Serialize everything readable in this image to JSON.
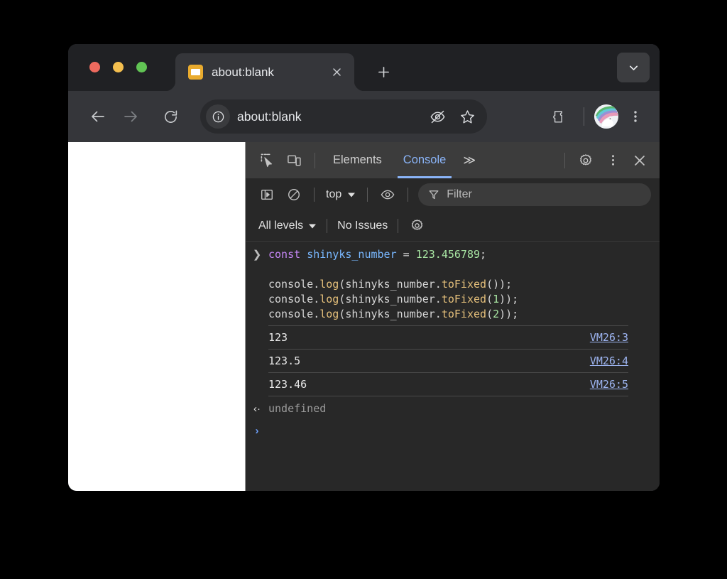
{
  "browser": {
    "tab": {
      "title": "about:blank",
      "favicon_icon": "page-favicon",
      "close_icon": "close-icon"
    },
    "new_tab_icon": "plus-icon",
    "tab_list_icon": "chevron-down-icon",
    "toolbar": {
      "back_icon": "arrow-left-icon",
      "forward_icon": "arrow-right-icon",
      "reload_icon": "reload-icon",
      "site_info_icon": "info-circle-icon",
      "url": "about:blank",
      "hide_icon": "eye-slash-icon",
      "bookmark_icon": "star-icon",
      "extensions_icon": "puzzle-piece-icon",
      "profile_icon": "unicorn-avatar",
      "menu_icon": "three-dots-vertical-icon"
    }
  },
  "devtools": {
    "inspect_icon": "inspect-element-icon",
    "device_toolbar_icon": "device-toolbar-icon",
    "tabs": [
      {
        "label": "Elements",
        "active": false
      },
      {
        "label": "Console",
        "active": true
      }
    ],
    "more_tabs_label": "≫",
    "settings_icon": "gear-icon",
    "more_options_icon": "three-dots-vertical-icon",
    "close_icon": "close-icon",
    "console_toolbar": {
      "sidebar_icon": "console-sidebar-icon",
      "clear_icon": "clear-console-icon",
      "context_label": "top",
      "context_chevron_icon": "chevron-down-icon",
      "live_expression_icon": "eye-icon",
      "filter_icon": "filter-funnel-icon",
      "filter_placeholder": "Filter",
      "filter_value": ""
    },
    "console_filterbar": {
      "levels_label": "All levels",
      "levels_chevron_icon": "chevron-down-icon",
      "issues_label": "No Issues",
      "issues_settings_icon": "gear-icon"
    },
    "console": {
      "input_prompt_icon": "chevron-right-icon",
      "input_lines": [
        [
          {
            "t": "const",
            "c": "tok-kw"
          },
          {
            "t": " ",
            "c": "tok-plain"
          },
          {
            "t": "shinyks_number",
            "c": "tok-var"
          },
          {
            "t": " = ",
            "c": "tok-plain"
          },
          {
            "t": "123.456789",
            "c": "tok-num"
          },
          {
            "t": ";",
            "c": "tok-plain"
          }
        ],
        [
          {
            "t": "",
            "c": "tok-plain"
          }
        ],
        [
          {
            "t": "console.",
            "c": "tok-plain"
          },
          {
            "t": "log",
            "c": "tok-fn"
          },
          {
            "t": "(shinyks_number.",
            "c": "tok-plain"
          },
          {
            "t": "toFixed",
            "c": "tok-fn"
          },
          {
            "t": "());",
            "c": "tok-plain"
          }
        ],
        [
          {
            "t": "console.",
            "c": "tok-plain"
          },
          {
            "t": "log",
            "c": "tok-fn"
          },
          {
            "t": "(shinyks_number.",
            "c": "tok-plain"
          },
          {
            "t": "toFixed",
            "c": "tok-fn"
          },
          {
            "t": "(",
            "c": "tok-plain"
          },
          {
            "t": "1",
            "c": "tok-num"
          },
          {
            "t": "));",
            "c": "tok-plain"
          }
        ],
        [
          {
            "t": "console.",
            "c": "tok-plain"
          },
          {
            "t": "log",
            "c": "tok-fn"
          },
          {
            "t": "(shinyks_number.",
            "c": "tok-plain"
          },
          {
            "t": "toFixed",
            "c": "tok-fn"
          },
          {
            "t": "(",
            "c": "tok-plain"
          },
          {
            "t": "2",
            "c": "tok-num"
          },
          {
            "t": "));",
            "c": "tok-plain"
          }
        ]
      ],
      "log_entries": [
        {
          "value": "123",
          "source": "VM26:3"
        },
        {
          "value": "123.5",
          "source": "VM26:4"
        },
        {
          "value": "123.46",
          "source": "VM26:5"
        }
      ],
      "result": {
        "arrow_icon": "result-arrow-icon",
        "arrow_glyph": "‹·",
        "value": "undefined"
      },
      "prompt": {
        "caret_glyph": "›"
      }
    }
  },
  "colors": {
    "accent_blue": "#8ab4f8",
    "window_chrome": "#35363a",
    "tabstrip": "#202124",
    "devtools_bg": "#282828",
    "devtools_tabbar": "#3c3c3c",
    "favicon": "#e9ab2e",
    "source_link": "#9db4f0"
  }
}
